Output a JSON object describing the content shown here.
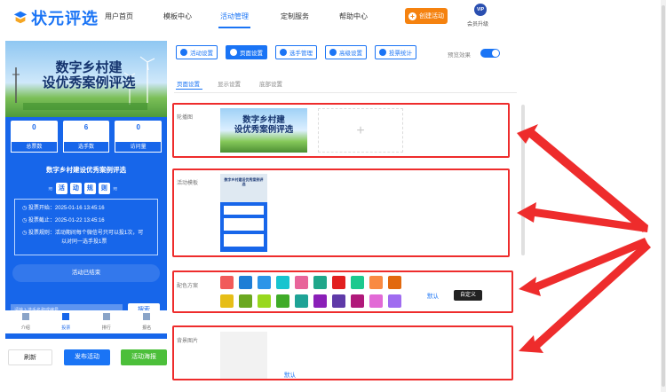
{
  "brand": {
    "name": "状元评选"
  },
  "nav": {
    "items": [
      "用户首页",
      "模板中心",
      "活动管理",
      "定制服务",
      "帮助中心"
    ],
    "create_label": "创建活动",
    "vip_badge": "VIP",
    "vip_label": "会员升级"
  },
  "phone": {
    "banner_title_line1": "数字乡村建",
    "banner_title_line2": "设优秀案例评选",
    "stats": [
      {
        "value": "0",
        "label": "总票数"
      },
      {
        "value": "6",
        "label": "选手数"
      },
      {
        "value": "0",
        "label": "访问量"
      }
    ],
    "title": "数字乡村建设优秀案例评选",
    "rules_chars": [
      "活",
      "动",
      "规",
      "则"
    ],
    "vote_start": "投票开始：2025-01-16 13:45:16",
    "vote_end": "投票截止：2025-01-22 13:45:16",
    "vote_rule_1": "投票规则：活动期间每个微信号只可以投1次，可",
    "vote_rule_2": "以对同一选手投1票",
    "ended_text": "活动已结束",
    "search_placeholder": "请输入选手名称或编号",
    "search_button": "搜索",
    "tabs": [
      "介绍",
      "投票",
      "排行",
      "报名"
    ]
  },
  "actions": {
    "refresh": "刷新",
    "publish": "发布活动",
    "poster": "活动海报"
  },
  "settings": {
    "top_buttons": [
      "活动设置",
      "页面设置",
      "选手管理",
      "高级设置",
      "投票统计"
    ],
    "preview_label": "预览效果",
    "preview_enabled": true,
    "subtabs": [
      "页面设置",
      "显示设置",
      "底部设置"
    ],
    "carousel_label": "轮播图",
    "carousel_img_line1": "数字乡村建",
    "carousel_img_line2": "设优秀案例评选",
    "add_symbol": "+",
    "template_label": "活动模板",
    "template_thumb_title": "数字乡村建设优秀案例评选",
    "color_label": "配色方案",
    "colors_row1": [
      "#f15a5a",
      "#1e7ed6",
      "#2c95e8",
      "#17c4cf",
      "#e8649a",
      "#1fa68a",
      "#e21f1f",
      "#1dc98e",
      "#f98a42",
      "#e2690e"
    ],
    "colors_row2": [
      "#e6be17",
      "#6ba820",
      "#98d81e",
      "#3fab28",
      "#1ea396",
      "#8a1fb8",
      "#5f3aa8",
      "#b0197a",
      "#e26ad6",
      "#a06cf0"
    ],
    "color_default": "默认",
    "color_custom": "自定义",
    "bg_label": "背景图片",
    "bg_default": "默认"
  },
  "accent": "#1a74f5",
  "annotation_color": "#ee2c2c"
}
